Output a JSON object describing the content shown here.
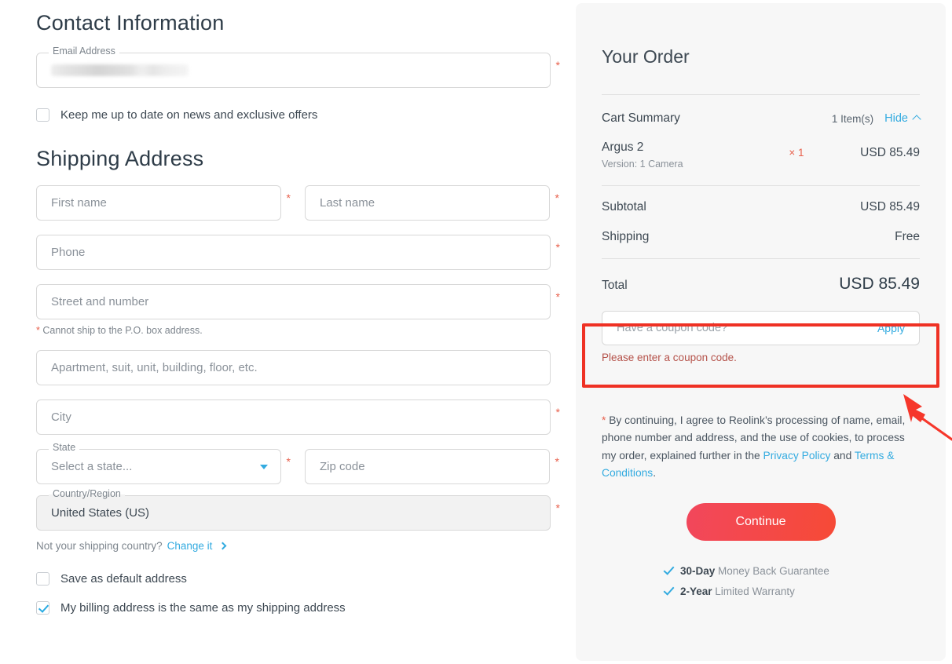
{
  "contact": {
    "title": "Contact Information",
    "email_label": "Email Address",
    "email_value_redacted": "",
    "newsletter_label": "Keep me up to date on news and exclusive offers"
  },
  "shipping": {
    "title": "Shipping Address",
    "first_name_placeholder": "First name",
    "last_name_placeholder": "Last name",
    "phone_placeholder": "Phone",
    "street_placeholder": "Street and number",
    "po_box_note": "Cannot ship to the P.O. box address.",
    "apartment_placeholder": "Apartment, suit, unit, building, floor, etc.",
    "city_placeholder": "City",
    "state_label": "State",
    "state_value": "Select a state...",
    "zip_placeholder": "Zip code",
    "country_label": "Country/Region",
    "country_value": "United States (US)",
    "change_country_text": "Not your shipping country?",
    "change_country_link": "Change it",
    "save_default_label": "Save as default address",
    "billing_same_label": "My billing address is the same as my shipping address",
    "required_marker": "*"
  },
  "order": {
    "title": "Your Order",
    "cart_summary_label": "Cart Summary",
    "item_count": "1 Item(s)",
    "hide_label": "Hide",
    "items": [
      {
        "name": "Argus 2",
        "variant": "Version:  1 Camera",
        "quantity": "× 1",
        "price": "USD 85.49"
      }
    ],
    "subtotal_label": "Subtotal",
    "subtotal_value": "USD 85.49",
    "shipping_label": "Shipping",
    "shipping_value": "Free",
    "total_label": "Total",
    "total_value": "USD 85.49",
    "coupon_placeholder": "Have a coupon code?",
    "coupon_apply_label": "Apply",
    "coupon_error": "Please enter a coupon code.",
    "consent_star": "*",
    "consent_text_1": " By continuing, I agree to Reolink’s processing of name, email, phone number and address, and the use of cookies, to process my order, explained further in the ",
    "consent_link_privacy": "Privacy Policy",
    "consent_text_2": " and ",
    "consent_link_terms": "Terms & Conditions",
    "consent_text_3": ".",
    "continue_label": "Continue",
    "badges": [
      {
        "strong": "30-Day",
        "rest": " Money Back Guarantee"
      },
      {
        "strong": "2-Year",
        "rest": " Limited Warranty"
      }
    ]
  },
  "colors": {
    "accent_blue": "#33ABE0",
    "accent_red": "#f2475c",
    "annotation_red": "#ef3124",
    "required_star": "#e8604c",
    "panel_bg": "#f7f7f7",
    "error_text": "#b5524a"
  }
}
